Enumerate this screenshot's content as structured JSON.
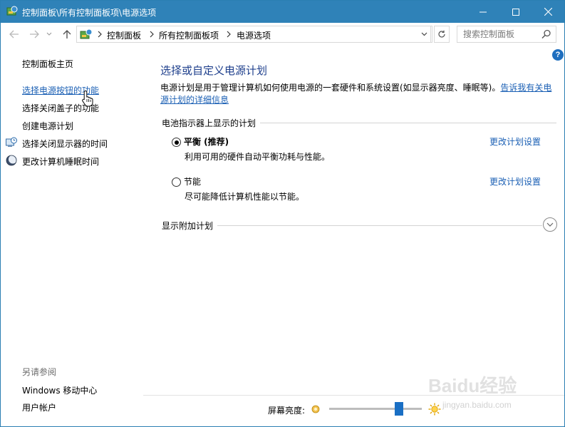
{
  "window": {
    "title": "控制面板\\所有控制面板项\\电源选项"
  },
  "address_bar": {
    "breadcrumbs": [
      "控制面板",
      "所有控制面板项",
      "电源选项"
    ],
    "search_placeholder": "搜索控制面板"
  },
  "help": {
    "glyph": "?"
  },
  "sidebar": {
    "home": "控制面板主页",
    "items": [
      {
        "label": "选择电源按钮的功能",
        "icon": null
      },
      {
        "label": "选择关闭盖子的功能",
        "icon": null
      },
      {
        "label": "创建电源计划",
        "icon": null
      },
      {
        "label": "选择关闭显示器的时间",
        "icon": "display-clock-icon"
      },
      {
        "label": "更改计算机睡眠时间",
        "icon": "moon-sleep-icon"
      }
    ],
    "see_also_title": "另请参阅",
    "see_also": [
      "Windows 移动中心",
      "用户帐户"
    ]
  },
  "main": {
    "title": "选择或自定义电源计划",
    "description": "电源计划是用于管理计算机如何使用电源的一套硬件和系统设置(如显示器亮度、睡眠等)。",
    "description_link": "告诉我有关电源计划的详细信息",
    "section_heading": "电池指示器上显示的计划",
    "plans": [
      {
        "name": "平衡 (推荐)",
        "description": "利用可用的硬件自动平衡功耗与性能。",
        "selected": true,
        "change_label": "更改计划设置"
      },
      {
        "name": "节能",
        "description": "尽可能降低计算机性能以节能。",
        "selected": false,
        "change_label": "更改计划设置"
      }
    ],
    "show_more_label": "显示附加计划"
  },
  "brightness": {
    "label": "屏幕亮度:",
    "level_fraction": 0.78
  },
  "watermark": {
    "text": "Baidu经验",
    "sub": "jingyan.baidu.com"
  },
  "colors": {
    "titlebar": "#2f82b8",
    "link": "#1a5fb4",
    "heading": "#1e3f8c",
    "slider_thumb": "#1a6fc4"
  }
}
